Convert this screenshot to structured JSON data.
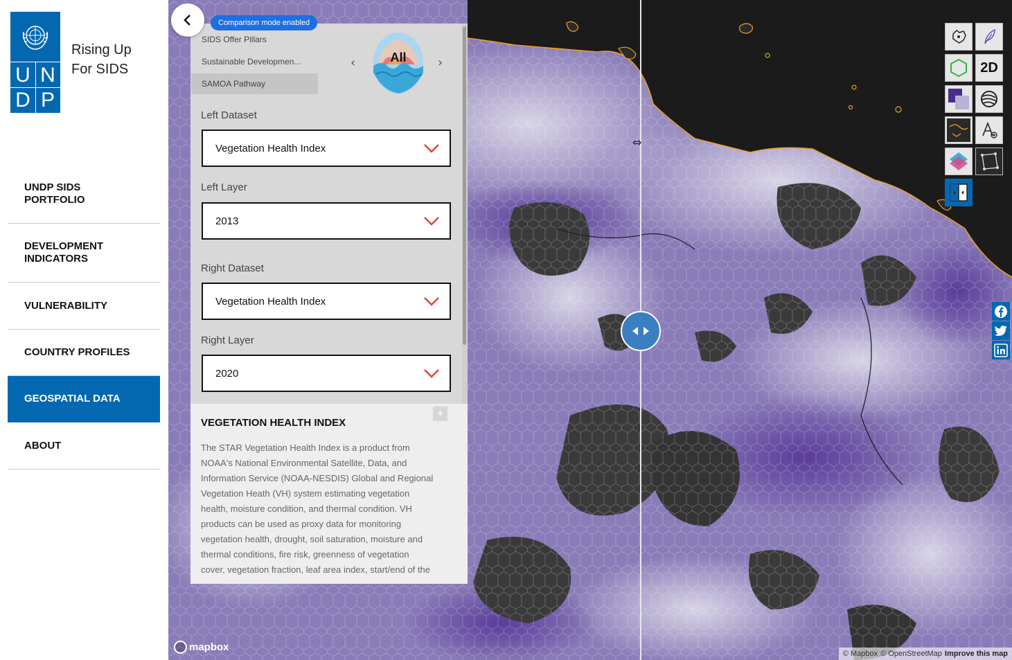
{
  "brand": {
    "tagline_line1": "Rising Up",
    "tagline_line2": "For SIDS",
    "logo_letters": [
      "U",
      "N",
      "D",
      "P"
    ]
  },
  "nav": {
    "items": [
      {
        "label_line1": "UNDP SIDS",
        "label_line2": "PORTFOLIO",
        "active": false
      },
      {
        "label_line1": "DEVELOPMENT",
        "label_line2": "INDICATORS",
        "active": false
      },
      {
        "label_line1": "VULNERABILITY",
        "label_line2": "",
        "active": false
      },
      {
        "label_line1": "COUNTRY PROFILES",
        "label_line2": "",
        "active": false
      },
      {
        "label_line1": "GEOSPATIAL DATA",
        "label_line2": "",
        "active": true
      },
      {
        "label_line1": "ABOUT",
        "label_line2": "",
        "active": false
      }
    ]
  },
  "panel": {
    "comparison_badge": "Comparison mode enabled",
    "pillar_tabs": [
      {
        "label": "SIDS Offer Pillars",
        "active": false
      },
      {
        "label": "Sustainable Developmen...",
        "active": false
      },
      {
        "label": "SAMOA Pathway",
        "active": true
      }
    ],
    "carousel_icon_label": "All",
    "left_dataset_label": "Left Dataset",
    "left_dataset_value": "Vegetation Health Index",
    "left_layer_label": "Left Layer",
    "left_layer_value": "2013",
    "right_dataset_label": "Right Dataset",
    "right_dataset_value": "Vegetation Health Index",
    "right_layer_label": "Right Layer",
    "right_layer_value": "2020"
  },
  "description": {
    "title": "VEGETATION HEALTH INDEX",
    "expand_label": "+",
    "lines": [
      "The STAR Vegetation Health Index is a product from",
      "NOAA's National Environmental Satellite, Data, and",
      "Information Service (NOAA-NESDIS) Global and Regional",
      "Vegetation Heath (VH) system estimating vegetation",
      "health, moisture condition, and thermal condition. VH",
      "products can be used as proxy data for monitoring",
      "vegetation health, drought, soil saturation, moisture and",
      "thermal conditions, fire risk, greenness of vegetation",
      "cover, vegetation fraction, leaf area index, start/end of the"
    ]
  },
  "map_tools": {
    "btn_2d_label": "2D",
    "icons": [
      "region-select-icon",
      "feather-icon",
      "hexagon-icon",
      "2d-toggle-icon",
      "layer-blend-icon",
      "globe-icon",
      "boundary-icon",
      "label-add-icon",
      "layers-icon",
      "polygon-draw-icon",
      "compare-mode-icon"
    ]
  },
  "attribution": {
    "mapbox_logo": "mapbox",
    "copyright_mapbox": "© Mapbox",
    "copyright_osm": "© OpenStreetMap",
    "improve": "Improve this map"
  },
  "colors": {
    "brand_blue": "#0468b1",
    "badge_blue": "#1f6fe0",
    "chevron_red": "#e0442a",
    "coastline_orange": "#f0a020"
  }
}
